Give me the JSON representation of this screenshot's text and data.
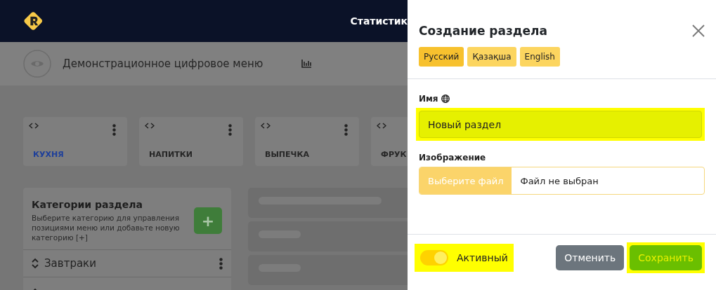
{
  "header": {
    "nav_label": "Статистик"
  },
  "menu_bar": {
    "title": "Демонстрационное цифровое меню"
  },
  "sections": [
    {
      "label": "КУХНЯ",
      "selected": true
    },
    {
      "label": "НАПИТКИ",
      "selected": false
    },
    {
      "label": "ВЫПЕЧКА",
      "selected": false
    },
    {
      "label": "ФРУК",
      "selected": false
    }
  ],
  "categories_panel": {
    "title": "Категории раздела",
    "description": "Выберите категорию для управления позициями меню или добавьте новую категорию [+]",
    "add_label": "+",
    "items": [
      {
        "label": "Завтраки"
      }
    ]
  },
  "dialog": {
    "title": "Создание раздела",
    "languages": [
      {
        "label": "Русский",
        "selected": true
      },
      {
        "label": "Қазақша",
        "selected": false
      },
      {
        "label": "English",
        "selected": false
      }
    ],
    "name_field": {
      "label": "Имя",
      "value": "Новый раздел",
      "highlighted": true
    },
    "image_field": {
      "label": "Изображение",
      "button": "Выберите файл",
      "status": "Файл не выбран"
    },
    "active_toggle": {
      "label": "Активный",
      "on": true,
      "highlighted": true
    },
    "buttons": [
      {
        "kind": "secondary",
        "label": "Отменить",
        "highlighted": false
      },
      {
        "kind": "primary",
        "label": "Сохранить",
        "highlighted": true
      }
    ]
  }
}
